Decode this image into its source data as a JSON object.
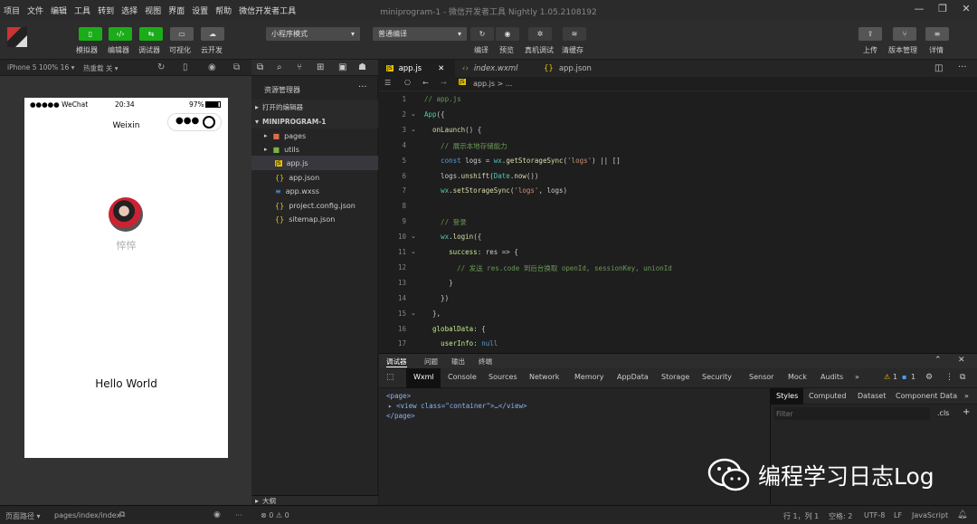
{
  "menu": [
    "项目",
    "文件",
    "编辑",
    "工具",
    "转到",
    "选择",
    "视图",
    "界面",
    "设置",
    "帮助",
    "微信开发者工具"
  ],
  "window_title": "miniprogram-1 - 微信开发者工具 Nightly 1.05.2108192",
  "toolbar": {
    "buttons": [
      "模拟器",
      "编辑器",
      "调试器",
      "可视化",
      "云开发"
    ],
    "mode_select": "小程序模式",
    "compile_select": "普通编译",
    "actions": [
      "编译",
      "预览",
      "真机调试",
      "清缓存"
    ],
    "right_actions": [
      "上传",
      "版本管理",
      "详情"
    ]
  },
  "simulator": {
    "device": "iPhone 5 100% 16 ▾",
    "hot_reload": "热重载 关 ▾",
    "status_carrier": "●●●●● WeChat",
    "status_time": "20:34",
    "status_battery": "97%",
    "nav_title": "Weixin",
    "nickname": "悴悴",
    "hello": "Hello World"
  },
  "explorer": {
    "title": "资源管理器",
    "open_editors": "打开的编辑器",
    "project": "MINIPROGRAM-1",
    "items": [
      {
        "name": "pages",
        "icon": "folder-icon"
      },
      {
        "name": "utils",
        "icon": "folder-icon"
      },
      {
        "name": "app.js",
        "icon": "js-icon"
      },
      {
        "name": "app.json",
        "icon": "json-icon"
      },
      {
        "name": "app.wxss",
        "icon": "wxss-icon"
      },
      {
        "name": "project.config.json",
        "icon": "json-icon"
      },
      {
        "name": "sitemap.json",
        "icon": "json-icon"
      }
    ],
    "outline": "大纲"
  },
  "editor": {
    "tabs": [
      "app.js",
      "index.wxml",
      "app.json"
    ],
    "breadcrumb": "app.js > ...",
    "lines": [
      "// app.js",
      "App({",
      "  onLaunch() {",
      "    // 展示本地存储能力",
      "    const logs = wx.getStorageSync('logs') || []",
      "    logs.unshift(Date.now())",
      "    wx.setStorageSync('logs', logs)",
      "",
      "    // 登录",
      "    wx.login({",
      "      success: res => {",
      "        // 发送 res.code 到后台换取 openId, sessionKey, unionId",
      "      }",
      "    })",
      "  },",
      "  globalData: {",
      "    userInfo: null"
    ]
  },
  "devtools": {
    "top_tabs": [
      "调试器",
      "问题",
      "输出",
      "终端"
    ],
    "tabs": [
      "Wxml",
      "Console",
      "Sources",
      "Network",
      "Memory",
      "AppData",
      "Storage",
      "Security",
      "Sensor",
      "Mock",
      "Audits",
      "»"
    ],
    "badge_warn": "1",
    "badge_info": "1",
    "wxml_lines": [
      "<page>",
      "▸ <view class=\"container\">…</view>",
      "</page>"
    ],
    "style_tabs": [
      "Styles",
      "Computed",
      "Dataset",
      "Component Data",
      "»"
    ],
    "filter_placeholder": "Filter",
    "cls": ".cls",
    "plus": "+"
  },
  "statusbar": {
    "path_label": "页面路径 ▾",
    "path": "pages/index/index",
    "errors": "⊗ 0 ⚠ 0",
    "position": "行 1，列 1",
    "spaces": "空格: 2",
    "encoding": "UTF-8",
    "eol": "LF",
    "language": "JavaScript"
  },
  "watermark": "编程学习日志Log"
}
